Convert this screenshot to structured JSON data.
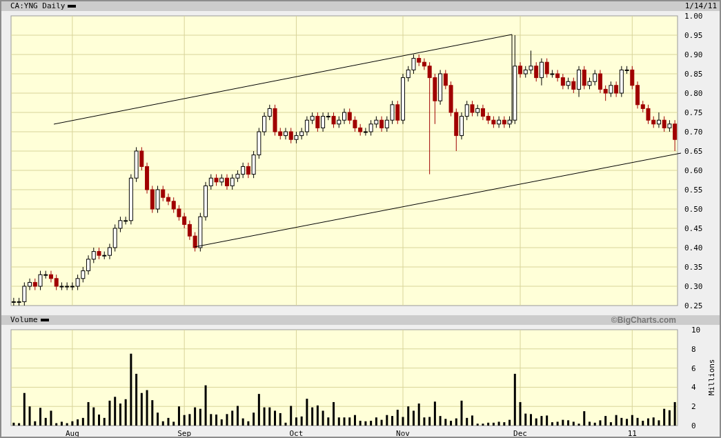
{
  "header": {
    "date": "1/14/11"
  },
  "price_panel": {
    "chart_data": {
      "type": "candlestick",
      "title": "CA:YNG Daily",
      "grid": true,
      "ylim": [
        0.25,
        1.0
      ],
      "yticks": [
        {
          "value": 1.0,
          "label": "1.00"
        },
        {
          "value": 0.95,
          "label": "0.95"
        },
        {
          "value": 0.9,
          "label": "0.90"
        },
        {
          "value": 0.85,
          "label": "0.85"
        },
        {
          "value": 0.8,
          "label": "0.80"
        },
        {
          "value": 0.75,
          "label": "0.75"
        },
        {
          "value": 0.7,
          "label": "0.70"
        },
        {
          "value": 0.65,
          "label": "0.65"
        },
        {
          "value": 0.6,
          "label": "0.60"
        },
        {
          "value": 0.55,
          "label": "0.55"
        },
        {
          "value": 0.5,
          "label": "0.50"
        },
        {
          "value": 0.45,
          "label": "0.45"
        },
        {
          "value": 0.4,
          "label": "0.40"
        },
        {
          "value": 0.35,
          "label": "0.35"
        },
        {
          "value": 0.3,
          "label": "0.30"
        },
        {
          "value": 0.25,
          "label": "0.25"
        }
      ],
      "categories": [
        null,
        null,
        null,
        null,
        null,
        null,
        null,
        null,
        null,
        null,
        null,
        null,
        null,
        null,
        null,
        null,
        null,
        null,
        null,
        null,
        null,
        null,
        null,
        null,
        null,
        null,
        null,
        null,
        null,
        null,
        null,
        null,
        null,
        null,
        null,
        null,
        null,
        null,
        null,
        null,
        null,
        null,
        null,
        null,
        null,
        null,
        null,
        null,
        null,
        null,
        null,
        null,
        null,
        null,
        null,
        null,
        null,
        null,
        null,
        null,
        null,
        null,
        null,
        null,
        null,
        null,
        null,
        null,
        null,
        null,
        null,
        null,
        null,
        null,
        null,
        null,
        null,
        null,
        null,
        null,
        null,
        null,
        null,
        null,
        null,
        null,
        null,
        null,
        null,
        null,
        null,
        null,
        null,
        null,
        null,
        null,
        null,
        null,
        null,
        null,
        null,
        null,
        null,
        null,
        null,
        null,
        null,
        null,
        null,
        null,
        null,
        null,
        null,
        null,
        null,
        null,
        null,
        null,
        null,
        null,
        null,
        null,
        null,
        null,
        null
      ],
      "ohlc": [
        [
          0.26,
          0.27,
          0.25,
          0.26
        ],
        [
          0.26,
          0.27,
          0.25,
          0.26
        ],
        [
          0.26,
          0.31,
          0.25,
          0.3
        ],
        [
          0.3,
          0.32,
          0.29,
          0.31
        ],
        [
          0.31,
          0.32,
          0.29,
          0.3
        ],
        [
          0.3,
          0.34,
          0.29,
          0.33
        ],
        [
          0.33,
          0.34,
          0.32,
          0.33
        ],
        [
          0.33,
          0.34,
          0.31,
          0.32
        ],
        [
          0.32,
          0.33,
          0.29,
          0.3
        ],
        [
          0.3,
          0.31,
          0.29,
          0.3
        ],
        [
          0.3,
          0.31,
          0.29,
          0.3
        ],
        [
          0.3,
          0.31,
          0.29,
          0.3
        ],
        [
          0.3,
          0.33,
          0.29,
          0.32
        ],
        [
          0.32,
          0.35,
          0.31,
          0.34
        ],
        [
          0.34,
          0.38,
          0.33,
          0.37
        ],
        [
          0.37,
          0.4,
          0.36,
          0.39
        ],
        [
          0.39,
          0.4,
          0.37,
          0.38
        ],
        [
          0.38,
          0.39,
          0.37,
          0.38
        ],
        [
          0.38,
          0.41,
          0.37,
          0.4
        ],
        [
          0.4,
          0.46,
          0.39,
          0.45
        ],
        [
          0.45,
          0.48,
          0.44,
          0.47
        ],
        [
          0.47,
          0.48,
          0.46,
          0.47
        ],
        [
          0.47,
          0.59,
          0.46,
          0.58
        ],
        [
          0.58,
          0.66,
          0.57,
          0.65
        ],
        [
          0.65,
          0.66,
          0.6,
          0.61
        ],
        [
          0.61,
          0.62,
          0.54,
          0.55
        ],
        [
          0.55,
          0.56,
          0.49,
          0.5
        ],
        [
          0.5,
          0.56,
          0.49,
          0.55
        ],
        [
          0.55,
          0.56,
          0.52,
          0.53
        ],
        [
          0.53,
          0.54,
          0.51,
          0.52
        ],
        [
          0.52,
          0.53,
          0.49,
          0.5
        ],
        [
          0.5,
          0.51,
          0.47,
          0.48
        ],
        [
          0.48,
          0.49,
          0.45,
          0.46
        ],
        [
          0.46,
          0.47,
          0.42,
          0.43
        ],
        [
          0.43,
          0.44,
          0.39,
          0.4
        ],
        [
          0.4,
          0.49,
          0.39,
          0.48
        ],
        [
          0.48,
          0.57,
          0.47,
          0.56
        ],
        [
          0.56,
          0.59,
          0.55,
          0.58
        ],
        [
          0.58,
          0.59,
          0.56,
          0.57
        ],
        [
          0.57,
          0.59,
          0.56,
          0.58
        ],
        [
          0.58,
          0.59,
          0.55,
          0.56
        ],
        [
          0.56,
          0.59,
          0.55,
          0.58
        ],
        [
          0.58,
          0.6,
          0.57,
          0.59
        ],
        [
          0.59,
          0.62,
          0.58,
          0.61
        ],
        [
          0.61,
          0.62,
          0.58,
          0.59
        ],
        [
          0.59,
          0.65,
          0.58,
          0.64
        ],
        [
          0.64,
          0.71,
          0.63,
          0.7
        ],
        [
          0.7,
          0.75,
          0.69,
          0.74
        ],
        [
          0.74,
          0.77,
          0.73,
          0.76
        ],
        [
          0.76,
          0.77,
          0.69,
          0.7
        ],
        [
          0.7,
          0.71,
          0.68,
          0.69
        ],
        [
          0.69,
          0.71,
          0.68,
          0.7
        ],
        [
          0.7,
          0.71,
          0.67,
          0.68
        ],
        [
          0.68,
          0.7,
          0.67,
          0.69
        ],
        [
          0.69,
          0.71,
          0.68,
          0.7
        ],
        [
          0.7,
          0.74,
          0.69,
          0.73
        ],
        [
          0.73,
          0.75,
          0.72,
          0.74
        ],
        [
          0.74,
          0.75,
          0.7,
          0.71
        ],
        [
          0.71,
          0.75,
          0.7,
          0.74
        ],
        [
          0.74,
          0.75,
          0.73,
          0.74
        ],
        [
          0.74,
          0.75,
          0.71,
          0.72
        ],
        [
          0.72,
          0.74,
          0.71,
          0.73
        ],
        [
          0.73,
          0.76,
          0.72,
          0.75
        ],
        [
          0.75,
          0.76,
          0.72,
          0.73
        ],
        [
          0.73,
          0.74,
          0.7,
          0.71
        ],
        [
          0.71,
          0.72,
          0.69,
          0.7
        ],
        [
          0.7,
          0.71,
          0.69,
          0.7
        ],
        [
          0.7,
          0.73,
          0.69,
          0.72
        ],
        [
          0.72,
          0.74,
          0.71,
          0.73
        ],
        [
          0.73,
          0.74,
          0.7,
          0.71
        ],
        [
          0.71,
          0.74,
          0.7,
          0.73
        ],
        [
          0.73,
          0.78,
          0.72,
          0.77
        ],
        [
          0.77,
          0.78,
          0.72,
          0.73
        ],
        [
          0.73,
          0.85,
          0.72,
          0.84
        ],
        [
          0.84,
          0.87,
          0.83,
          0.86
        ],
        [
          0.86,
          0.9,
          0.85,
          0.89
        ],
        [
          0.89,
          0.9,
          0.87,
          0.88
        ],
        [
          0.88,
          0.89,
          0.86,
          0.87
        ],
        [
          0.87,
          0.88,
          0.59,
          0.84
        ],
        [
          0.84,
          0.85,
          0.72,
          0.78
        ],
        [
          0.78,
          0.86,
          0.77,
          0.85
        ],
        [
          0.85,
          0.86,
          0.81,
          0.82
        ],
        [
          0.82,
          0.83,
          0.74,
          0.75
        ],
        [
          0.75,
          0.76,
          0.65,
          0.69
        ],
        [
          0.69,
          0.75,
          0.68,
          0.74
        ],
        [
          0.74,
          0.78,
          0.73,
          0.77
        ],
        [
          0.77,
          0.78,
          0.74,
          0.75
        ],
        [
          0.75,
          0.77,
          0.74,
          0.76
        ],
        [
          0.76,
          0.77,
          0.73,
          0.74
        ],
        [
          0.74,
          0.75,
          0.72,
          0.73
        ],
        [
          0.73,
          0.74,
          0.71,
          0.72
        ],
        [
          0.72,
          0.74,
          0.71,
          0.73
        ],
        [
          0.73,
          0.74,
          0.71,
          0.72
        ],
        [
          0.72,
          0.74,
          0.71,
          0.73
        ],
        [
          0.73,
          0.95,
          0.72,
          0.87
        ],
        [
          0.87,
          0.88,
          0.84,
          0.85
        ],
        [
          0.85,
          0.87,
          0.84,
          0.86
        ],
        [
          0.86,
          0.91,
          0.85,
          0.87
        ],
        [
          0.87,
          0.88,
          0.83,
          0.84
        ],
        [
          0.84,
          0.89,
          0.82,
          0.88
        ],
        [
          0.88,
          0.89,
          0.84,
          0.85
        ],
        [
          0.85,
          0.86,
          0.84,
          0.85
        ],
        [
          0.85,
          0.86,
          0.83,
          0.84
        ],
        [
          0.84,
          0.85,
          0.81,
          0.82
        ],
        [
          0.82,
          0.84,
          0.81,
          0.83
        ],
        [
          0.83,
          0.84,
          0.8,
          0.81
        ],
        [
          0.81,
          0.87,
          0.79,
          0.86
        ],
        [
          0.86,
          0.87,
          0.81,
          0.82
        ],
        [
          0.82,
          0.84,
          0.81,
          0.83
        ],
        [
          0.83,
          0.86,
          0.82,
          0.85
        ],
        [
          0.85,
          0.86,
          0.8,
          0.81
        ],
        [
          0.81,
          0.82,
          0.78,
          0.8
        ],
        [
          0.8,
          0.83,
          0.79,
          0.82
        ],
        [
          0.82,
          0.83,
          0.79,
          0.8
        ],
        [
          0.8,
          0.87,
          0.79,
          0.86
        ],
        [
          0.86,
          0.87,
          0.85,
          0.86
        ],
        [
          0.86,
          0.87,
          0.81,
          0.82
        ],
        [
          0.82,
          0.83,
          0.76,
          0.77
        ],
        [
          0.77,
          0.78,
          0.75,
          0.76
        ],
        [
          0.76,
          0.77,
          0.72,
          0.73
        ],
        [
          0.73,
          0.74,
          0.71,
          0.72
        ],
        [
          0.72,
          0.75,
          0.71,
          0.73
        ],
        [
          0.73,
          0.74,
          0.7,
          0.71
        ],
        [
          0.71,
          0.73,
          0.7,
          0.72
        ],
        [
          0.72,
          0.73,
          0.65,
          0.68
        ]
      ]
    }
  },
  "volume_panel": {
    "title": "Volume",
    "credit": "©BigCharts.com",
    "chart_data": {
      "type": "bar",
      "ylabel": "Millions",
      "grid": true,
      "ylim": [
        0,
        10
      ],
      "yticks": [
        0,
        2,
        4,
        6,
        8,
        10
      ],
      "categories": [
        null,
        null,
        null,
        null,
        null,
        null,
        null,
        null,
        null,
        null,
        null,
        "Aug",
        null,
        null,
        null,
        null,
        null,
        null,
        null,
        null,
        null,
        null,
        null,
        null,
        null,
        null,
        null,
        null,
        null,
        null,
        null,
        null,
        "Sep",
        null,
        null,
        null,
        null,
        null,
        null,
        null,
        null,
        null,
        null,
        null,
        null,
        null,
        null,
        null,
        null,
        null,
        null,
        null,
        null,
        "Oct",
        null,
        null,
        null,
        null,
        null,
        null,
        null,
        null,
        null,
        null,
        null,
        null,
        null,
        null,
        null,
        null,
        null,
        null,
        null,
        "Nov",
        null,
        null,
        null,
        null,
        null,
        null,
        null,
        null,
        null,
        null,
        null,
        null,
        null,
        null,
        null,
        null,
        null,
        null,
        null,
        null,
        null,
        "Dec",
        null,
        null,
        null,
        null,
        null,
        null,
        null,
        null,
        null,
        null,
        null,
        null,
        null,
        null,
        null,
        null,
        null,
        null,
        null,
        null,
        "11",
        null,
        null,
        null,
        null,
        null,
        null,
        null,
        null
      ],
      "series": [
        {
          "color": "#000000",
          "values": [
            0.3,
            0.25,
            3.4,
            2.0,
            0.45,
            1.85,
            0.8,
            1.55,
            0.25,
            0.4,
            0.25,
            0.45,
            0.65,
            0.8,
            2.45,
            1.9,
            1.15,
            0.8,
            2.6,
            3.0,
            2.3,
            2.75,
            7.5,
            5.4,
            3.4,
            3.7,
            2.65,
            1.35,
            0.45,
            0.8,
            0.4,
            2.0,
            1.1,
            1.2,
            1.9,
            1.75,
            4.2,
            1.2,
            1.15,
            0.65,
            1.2,
            1.55,
            2.05,
            0.75,
            0.45,
            1.35,
            3.3,
            1.9,
            1.9,
            1.55,
            1.3,
            0.3,
            2.05,
            0.85,
            0.95,
            2.8,
            1.9,
            2.1,
            1.55,
            0.85,
            2.45,
            0.85,
            0.85,
            0.85,
            1.1,
            0.5,
            0.45,
            0.5,
            0.85,
            0.6,
            1.1,
            1.0,
            1.65,
            0.9,
            2.0,
            1.55,
            2.3,
            0.85,
            0.9,
            2.5,
            1.0,
            0.7,
            0.5,
            0.75,
            2.6,
            0.8,
            1.05,
            0.2,
            0.2,
            0.3,
            0.3,
            0.4,
            0.35,
            0.6,
            5.4,
            2.45,
            1.25,
            1.2,
            0.75,
            1.0,
            1.05,
            0.35,
            0.4,
            0.6,
            0.55,
            0.4,
            0.2,
            1.5,
            0.4,
            0.3,
            0.55,
            1.0,
            0.35,
            1.1,
            0.8,
            0.7,
            1.1,
            0.8,
            0.5,
            0.75,
            0.85,
            0.55,
            1.75,
            1.6,
            2.45
          ]
        }
      ]
    }
  }
}
